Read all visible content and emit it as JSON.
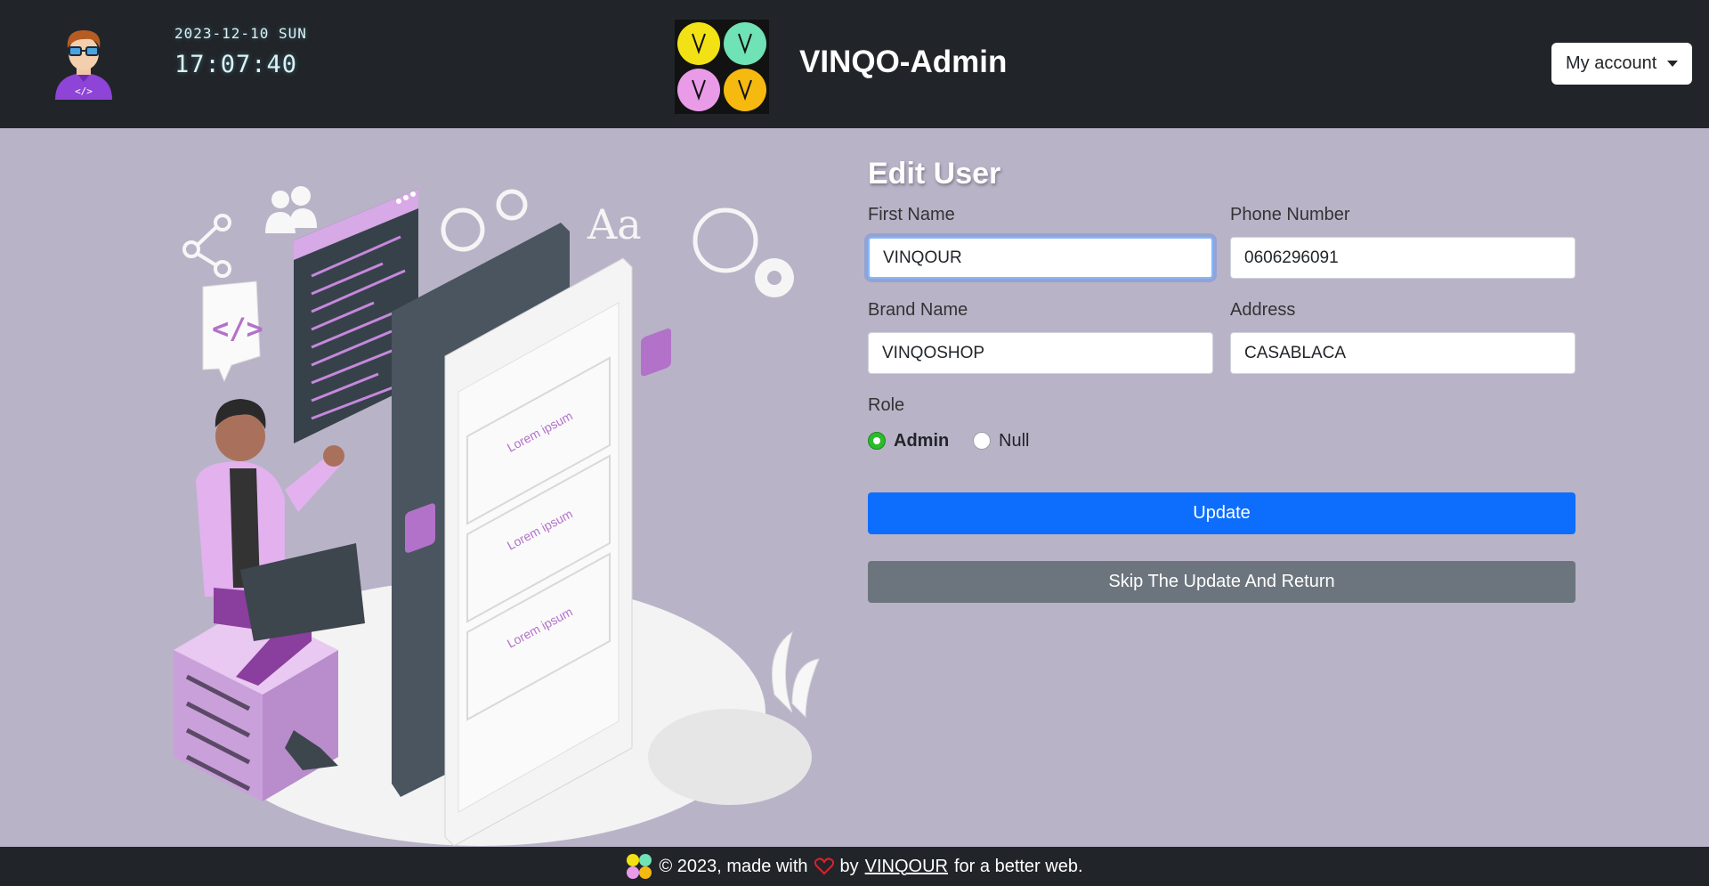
{
  "header": {
    "date": "2023-12-10 SUN",
    "time": "17:07:40",
    "brand": "VINQO-Admin",
    "account_label": "My account"
  },
  "illustration": {
    "lorem_1": "Lorem ipsum",
    "lorem_2": "Lorem ipsum",
    "lorem_3": "Lorem ipsum",
    "aa_text": "Aa",
    "code_tag": "</>"
  },
  "form": {
    "title": "Edit User",
    "first_name": {
      "label": "First Name",
      "value": "VINQOUR"
    },
    "phone": {
      "label": "Phone Number",
      "value": "0606296091"
    },
    "brand_name": {
      "label": "Brand Name",
      "value": "VINQOSHOP"
    },
    "address": {
      "label": "Address",
      "value": "CASABLACA"
    },
    "role": {
      "label": "Role",
      "options": [
        {
          "label": "Admin",
          "checked": true
        },
        {
          "label": "Null",
          "checked": false
        }
      ]
    },
    "update_label": "Update",
    "skip_label": "Skip The Update And Return"
  },
  "footer": {
    "prefix": "© 2023, made with",
    "by": "by",
    "author": "VINQOUR",
    "suffix": "for a better web."
  },
  "colors": {
    "background": "#b9b3c8",
    "header": "#212529",
    "primary": "#0d6efd",
    "secondary": "#6c757d",
    "radio_checked": "#2bbb2b",
    "accent_purple": "#b272c9"
  }
}
